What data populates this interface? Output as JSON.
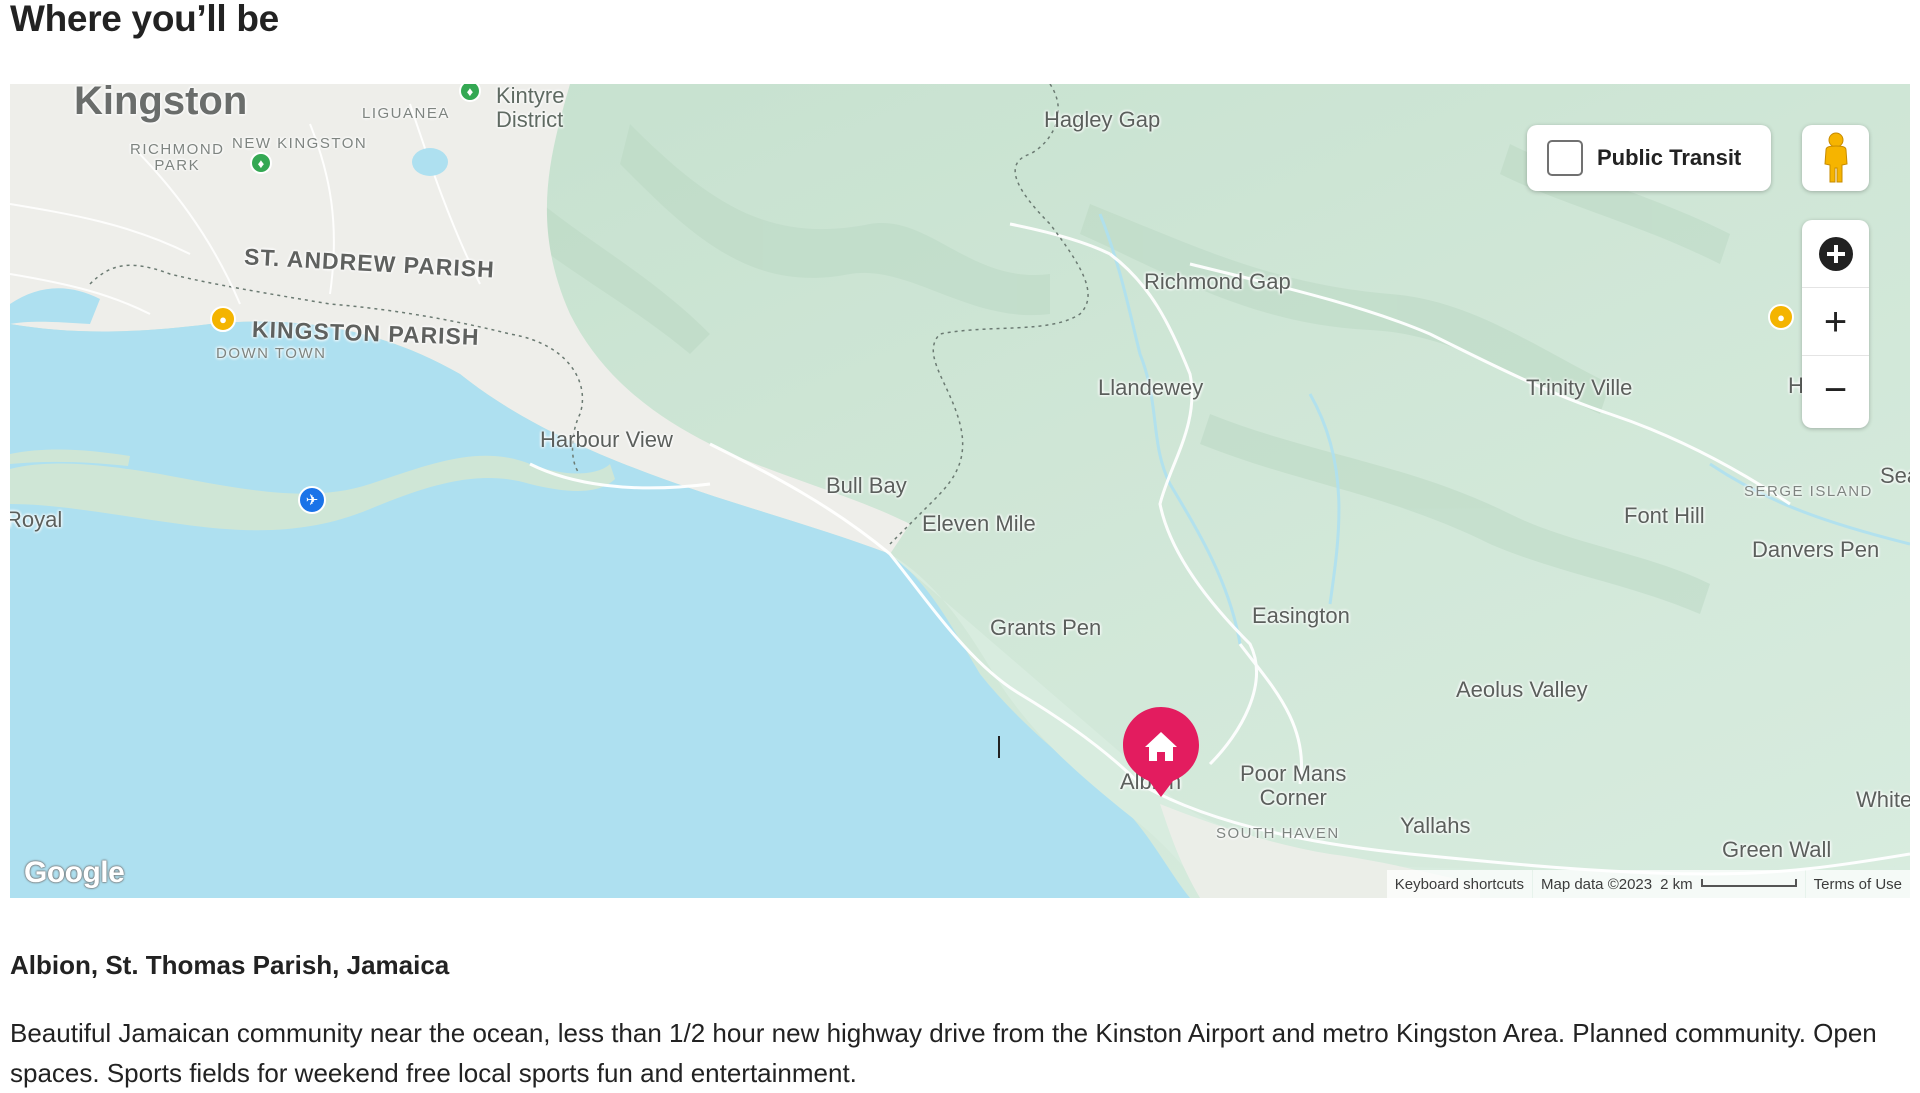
{
  "section": {
    "title": "Where you’ll be"
  },
  "map": {
    "labels": {
      "kingston": "Kingston",
      "liguanea": "LIGUANEA",
      "kintyre_district": [
        "Kintyre",
        "District"
      ],
      "new_kingston": "NEW KINGSTON",
      "richmond_park": [
        "RICHMOND",
        "PARK"
      ],
      "st_andrew_parish": "ST. ANDREW PARISH",
      "kingston_parish": "KINGSTON PARISH",
      "down_town": "DOWN TOWN",
      "harbour_view": "Harbour View",
      "royal": "Royal",
      "bull_bay": "Bull Bay",
      "eleven_mile": "Eleven Mile",
      "hagley_gap": "Hagley Gap",
      "richmond_gap": "Richmond Gap",
      "llandewey": "Llandewey",
      "trinity_ville": "Trinity Ville",
      "serge_island": "SERGE ISLAND",
      "sea": "Sea",
      "font_hill": "Font Hill",
      "danvers_pen": "Danvers Pen",
      "grants_pen": "Grants Pen",
      "easington": "Easington",
      "aeolus_valley": "Aeolus Valley",
      "albion": "Albion",
      "poor_mans_corner": [
        "Poor Mans",
        "Corner"
      ],
      "south_haven": "SOUTH HAVEN",
      "yallahs": "Yallahs",
      "white": "White",
      "green_wall": "Green Wall",
      "h_partial": "H"
    },
    "controls": {
      "public_transit_label": "Public Transit",
      "public_transit_checked": false,
      "zoom_in_symbol": "+",
      "zoom_out_symbol": "−"
    },
    "logo": "Google",
    "attribution": {
      "keyboard_shortcuts": "Keyboard shortcuts",
      "map_data": "Map data ©2023",
      "scale": "2 km",
      "terms": "Terms of Use"
    },
    "icons": {
      "pegman": "pegman-icon",
      "location": "my-location-icon",
      "home_pin": "home-pin-icon",
      "airport": "airplane-icon"
    },
    "colors": {
      "water": "#aee0f0",
      "land": "#d4ebdc",
      "pin": "#e31c5f"
    }
  },
  "listing": {
    "address": "Albion, St. Thomas Parish, Jamaica",
    "description": "Beautiful Jamaican community near the ocean, less than 1/2 hour new highway drive from the Kinston Airport and metro Kingston Area. Planned community. Open spaces. Sports fields for weekend free local sports fun and entertainment."
  }
}
